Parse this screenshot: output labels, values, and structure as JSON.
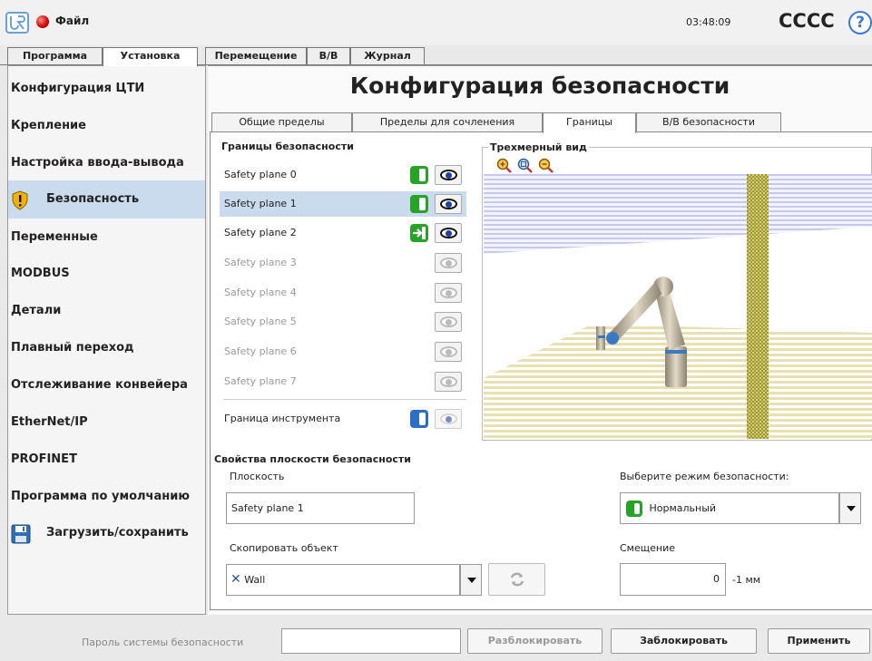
{
  "titlebar": {
    "file_label": "Файл",
    "clock": "03:48:09",
    "robot_name": "CCCC",
    "help_symbol": "?"
  },
  "top_tabs": [
    "Программа",
    "Установка",
    "Перемещение",
    "В/В",
    "Журнал"
  ],
  "active_top_tab": "Установка",
  "sidebar": {
    "items": [
      "Конфигурация ЦТИ",
      "Крепление",
      "Настройка ввода-вывода",
      "Безопасность",
      "Переменные",
      "MODBUS",
      "Детали",
      "Плавный переход",
      "Отслеживание конвейера",
      "EtherNet/IP",
      "PROFINET",
      "Программа по умолчанию",
      "Загрузить/сохранить"
    ],
    "active": "Безопасность"
  },
  "page_title": "Конфигурация безопасности",
  "sub_tabs": [
    "Общие пределы",
    "Пределы для сочленения",
    "Границы",
    "В/В безопасности"
  ],
  "active_sub_tab": "Границы",
  "limits_heading": "Границы безопасности",
  "planes": [
    {
      "label": "Safety plane 0",
      "enabled": true,
      "mode": "normal",
      "visible": true
    },
    {
      "label": "Safety plane 1",
      "enabled": true,
      "mode": "normal",
      "visible": true,
      "selected": true
    },
    {
      "label": "Safety plane 2",
      "enabled": true,
      "mode": "trigger-reduced",
      "visible": true
    },
    {
      "label": "Safety plane 3",
      "enabled": false
    },
    {
      "label": "Safety plane 4",
      "enabled": false
    },
    {
      "label": "Safety plane 5",
      "enabled": false
    },
    {
      "label": "Safety plane 6",
      "enabled": false
    },
    {
      "label": "Safety plane 7",
      "enabled": false
    }
  ],
  "tool_boundary_label": "Граница инструмента",
  "view3d_title": "Трехмерный вид",
  "zoom_icons": [
    "zoom-in-icon",
    "zoom-fit-icon",
    "zoom-out-icon"
  ],
  "props": {
    "heading": "Свойства плоскости безопасности",
    "plane_label": "Плоскость",
    "plane_value": "Safety plane 1",
    "copy_label": "Скопировать объект",
    "copy_value": "Wall",
    "mode_label": "Выберите режим безопасности:",
    "mode_value": "Нормальный",
    "offset_label": "Смещение",
    "offset_value": "0",
    "offset_unit": "-1 мм"
  },
  "bottom": {
    "password_label": "Пароль системы безопасности",
    "password_value": "",
    "unlock": "Разблокировать",
    "lock": "Заблокировать",
    "apply": "Применить"
  },
  "colors": {
    "accent_selected": "#c9dbed",
    "mode_green": "#27a327",
    "link_blue": "#3a7ad6"
  }
}
